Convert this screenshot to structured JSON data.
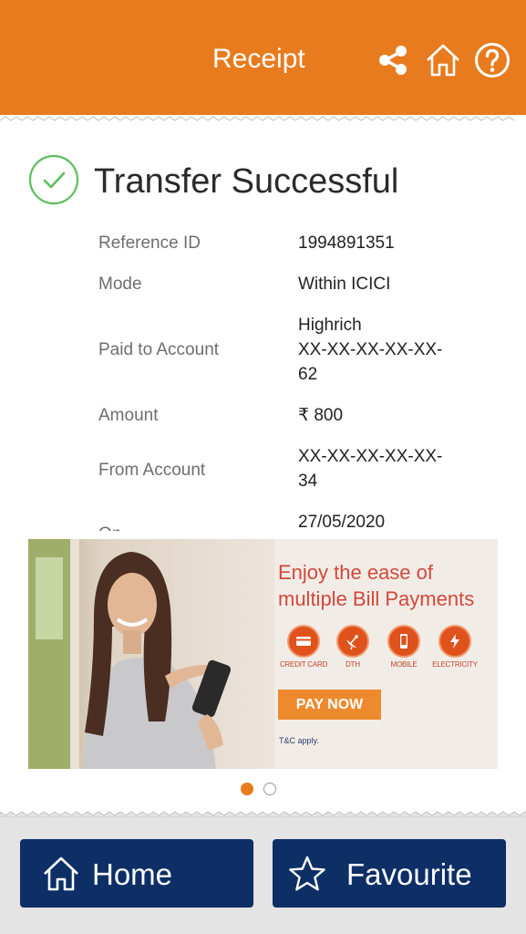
{
  "header": {
    "title": "Receipt",
    "color": "#e77b1e",
    "icons": [
      "share-icon",
      "home-icon",
      "help-icon"
    ]
  },
  "receipt": {
    "status": "Transfer Successful",
    "status_color": "#5cbf5c",
    "rows": [
      {
        "label": "Reference ID",
        "value": "1994891351"
      },
      {
        "label": "Mode",
        "value": "Within ICICI"
      },
      {
        "label": "Paid to Account",
        "value": "Highrich\nXX-XX-XX-XX-XX-\n62"
      },
      {
        "label": "Amount",
        "value": "₹ 800"
      },
      {
        "label": "From Account",
        "value": "XX-XX-XX-XX-XX-\n34"
      },
      {
        "label": "On",
        "value": "27/05/2020"
      }
    ]
  },
  "banner": {
    "headline": "Enjoy the ease of\nmultiple Bill Payments",
    "items": [
      {
        "label": "CREDIT CARD",
        "icon": "credit-card-icon"
      },
      {
        "label": "DTH",
        "icon": "satellite-dish-icon"
      },
      {
        "label": "MOBILE",
        "icon": "mobile-icon"
      },
      {
        "label": "ELECTRICITY",
        "icon": "electricity-icon"
      }
    ],
    "cta": "PAY NOW",
    "note": "T&C apply.",
    "accent": "#e0521c"
  },
  "carousel": {
    "count": 2,
    "active": 1
  },
  "footer": {
    "home_label": "Home",
    "favourite_label": "Favourite",
    "button_color": "#0d2f66"
  }
}
